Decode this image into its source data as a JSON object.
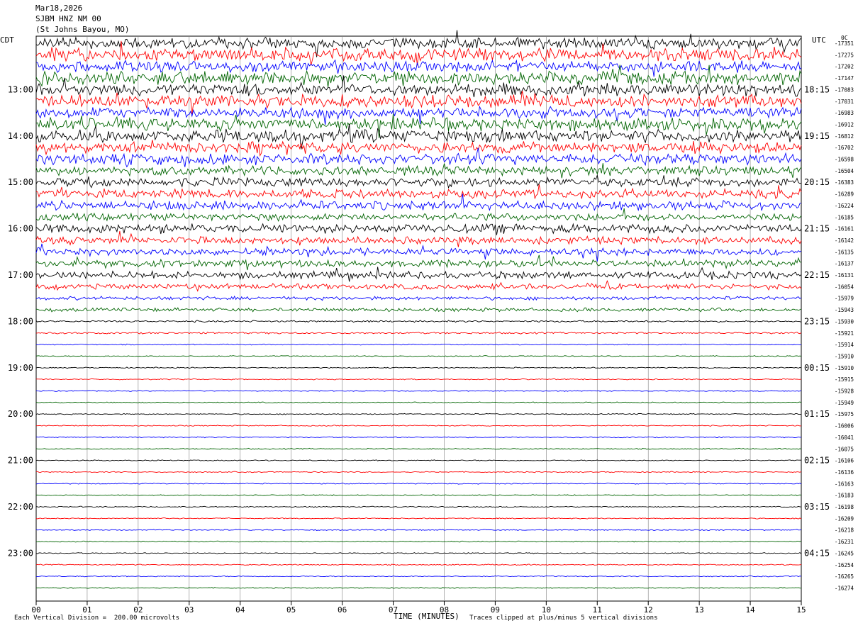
{
  "header": {
    "date": "Mar18,2026",
    "station": "SJBM HNZ NM 00",
    "location": "(St Johns Bayou, MO)"
  },
  "left_axis_label": "CDT",
  "right_axis_label": "UTC",
  "right_axis_unit": "0C",
  "footer": {
    "scale_note": "Each Vertical Division =  200.00 microvolts",
    "xlabel": "TIME (MINUTES)",
    "clip_note": "Traces clipped at plus/minus 5 vertical divisions"
  },
  "colors": {
    "black": "#000000",
    "red": "#ff0000",
    "blue": "#0000ff",
    "green": "#006400",
    "grid": "#808080"
  },
  "chart_data": {
    "type": "line",
    "title": "",
    "xlabel": "TIME (MINUTES)",
    "xlim": [
      0,
      15
    ],
    "x_ticks": [
      "00",
      "01",
      "02",
      "03",
      "04",
      "05",
      "06",
      "07",
      "08",
      "09",
      "10",
      "11",
      "12",
      "13",
      "14",
      "15"
    ],
    "minutes_per_line": 15,
    "series_color_cycle": [
      "black",
      "red",
      "blue",
      "green"
    ],
    "left_hour_labels": [
      "13:00",
      "14:00",
      "15:00",
      "16:00",
      "17:00",
      "18:00",
      "19:00",
      "20:00",
      "21:00",
      "22:00",
      "23:00"
    ],
    "right_hour_labels": [
      "18:15",
      "19:15",
      "20:15",
      "21:15",
      "22:15",
      "23:15",
      "00:15",
      "01:15",
      "02:15",
      "03:15",
      "04:15"
    ],
    "hour_label_start_line": 4,
    "line_offsets": [
      "-17351",
      "-17275",
      "-17202",
      "-17147",
      "-17083",
      "-17031",
      "-16983",
      "-16912",
      "-16812",
      "-16702",
      "-16598",
      "-16504",
      "-16383",
      "-16289",
      "-16224",
      "-16185",
      "-16161",
      "-16142",
      "-16135",
      "-16137",
      "-16131",
      "-16054",
      "-15979",
      "-15943",
      "-15930",
      "-15921",
      "-15914",
      "-15910",
      "-15910",
      "-15915",
      "-15928",
      "-15949",
      "-15975",
      "-16006",
      "-16041",
      "-16075",
      "-16106",
      "-16136",
      "-16163",
      "-16183",
      "-16198",
      "-16209",
      "-16218",
      "-16231",
      "-16245",
      "-16254",
      "-16265",
      "-16274"
    ],
    "line_activity": [
      6,
      7,
      6,
      7,
      7,
      7,
      6,
      7,
      7,
      6,
      6,
      5,
      5,
      5,
      5,
      4,
      5,
      4,
      4,
      4,
      4,
      3,
      2,
      2,
      1,
      1,
      0.6,
      0.6,
      0.6,
      0.6,
      0.6,
      0.6,
      0.6,
      0.6,
      0.6,
      0.6,
      0.6,
      0.6,
      0.6,
      0.6,
      0.6,
      0.6,
      0.6,
      0.6,
      0.6,
      0.6,
      0.6,
      0.6
    ]
  }
}
